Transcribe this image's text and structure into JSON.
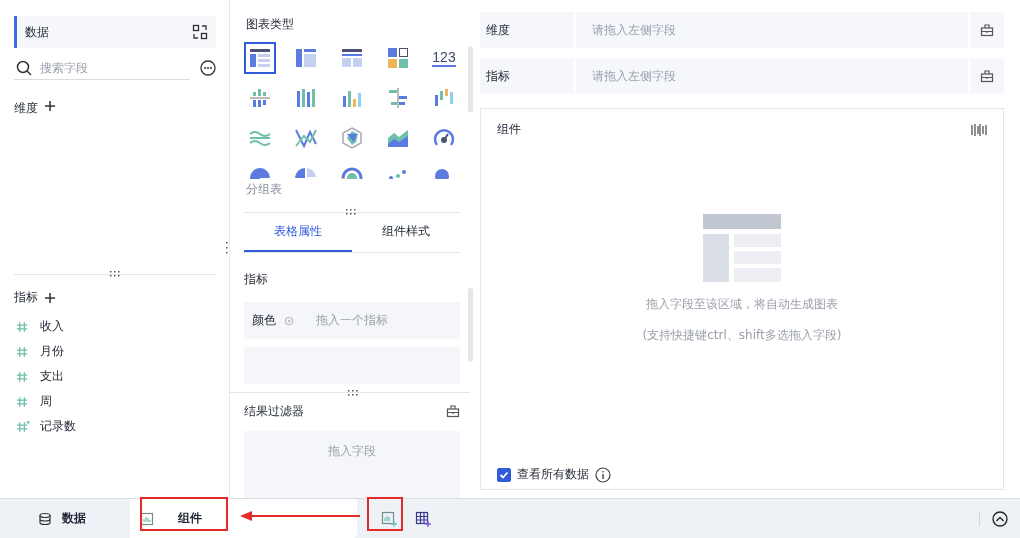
{
  "data_panel": {
    "title": "数据",
    "search": {
      "placeholder": "搜索字段"
    },
    "dimension_label": "维度",
    "measure_label": "指标",
    "fields": [
      {
        "name": "收入",
        "kind": "number"
      },
      {
        "name": "月份",
        "kind": "number"
      },
      {
        "name": "支出",
        "kind": "number"
      },
      {
        "name": "周",
        "kind": "number"
      },
      {
        "name": "记录数",
        "kind": "count"
      }
    ]
  },
  "chart_panel": {
    "title": "图表类型",
    "chart_types": [
      {
        "kind": "detail-table",
        "selected": true
      },
      {
        "kind": "group-table",
        "selected": false
      },
      {
        "kind": "cross-table",
        "selected": false
      },
      {
        "kind": "kpi-grid",
        "selected": false
      },
      {
        "kind": "number",
        "text": "123",
        "selected": false
      },
      {
        "kind": "stack-bar",
        "selected": false
      },
      {
        "kind": "multi-bar",
        "selected": false
      },
      {
        "kind": "column",
        "selected": false
      },
      {
        "kind": "bar",
        "selected": false
      },
      {
        "kind": "range-column",
        "selected": false
      },
      {
        "kind": "wave",
        "selected": false
      },
      {
        "kind": "cross-line",
        "selected": false
      },
      {
        "kind": "radar",
        "selected": false
      },
      {
        "kind": "area",
        "selected": false
      },
      {
        "kind": "gauge",
        "selected": false
      },
      {
        "kind": "pie",
        "selected": false
      },
      {
        "kind": "split-pie",
        "selected": false
      },
      {
        "kind": "sunburst",
        "selected": false
      },
      {
        "kind": "scatter",
        "selected": false
      },
      {
        "kind": "bubble",
        "selected": false
      }
    ],
    "caption": "分组表",
    "tabs": [
      {
        "label": "表格属性",
        "selected": true
      },
      {
        "label": "组件样式",
        "selected": false
      }
    ],
    "section_title": "指标",
    "attribute_rows": [
      {
        "label": "颜色",
        "placeholder": "拖入一个指标"
      }
    ],
    "filter": {
      "title": "结果过滤器",
      "placeholder": "拖入字段"
    }
  },
  "shelf": [
    {
      "label": "维度",
      "placeholder": "请拖入左侧字段"
    },
    {
      "label": "指标",
      "placeholder": "请拖入左侧字段"
    }
  ],
  "widget": {
    "title": "组件",
    "hint": "拖入字段至该区域，将自动生成图表",
    "subhint": "(支持快捷键ctrl、shift多选拖入字段)",
    "show_all": {
      "label": "查看所有数据",
      "checked": true
    }
  },
  "bottom_bar": {
    "tabs": [
      {
        "label": "数据",
        "kind": "data",
        "selected": false
      },
      {
        "label": "组件",
        "kind": "widget",
        "selected": true
      }
    ]
  }
}
